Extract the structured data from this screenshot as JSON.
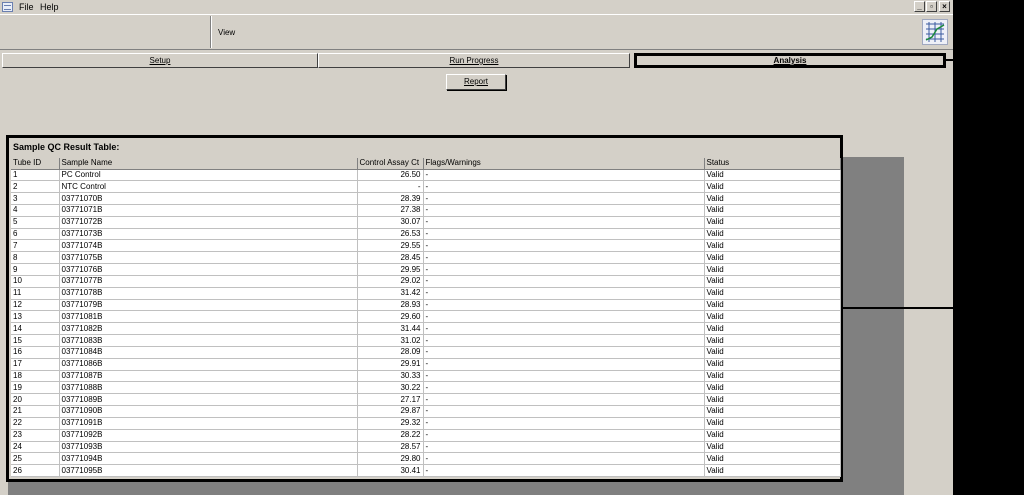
{
  "menu": {
    "file": "File",
    "help": "Help"
  },
  "window_buttons": {
    "minimize": "_",
    "restore": "▫",
    "close": "×"
  },
  "toolbar": {
    "view_label": "View"
  },
  "tabs": [
    {
      "label": "Setup"
    },
    {
      "label": "Run Progress"
    },
    {
      "label": "Analysis"
    }
  ],
  "report_button": "Report",
  "qc_table": {
    "title": "Sample QC Result Table:",
    "columns": [
      "Tube ID",
      "Sample Name",
      "Control Assay Ct",
      "Flags/Warnings",
      "Status"
    ],
    "rows": [
      [
        "1",
        "PC Control",
        "26.50",
        "-",
        "Valid"
      ],
      [
        "2",
        "NTC Control",
        "-",
        "-",
        "Valid"
      ],
      [
        "3",
        "03771070B",
        "28.39",
        "-",
        "Valid"
      ],
      [
        "4",
        "03771071B",
        "27.38",
        "-",
        "Valid"
      ],
      [
        "5",
        "03771072B",
        "30.07",
        "-",
        "Valid"
      ],
      [
        "6",
        "03771073B",
        "26.53",
        "-",
        "Valid"
      ],
      [
        "7",
        "03771074B",
        "29.55",
        "-",
        "Valid"
      ],
      [
        "8",
        "03771075B",
        "28.45",
        "-",
        "Valid"
      ],
      [
        "9",
        "03771076B",
        "29.95",
        "-",
        "Valid"
      ],
      [
        "10",
        "03771077B",
        "29.02",
        "-",
        "Valid"
      ],
      [
        "11",
        "03771078B",
        "31.42",
        "-",
        "Valid"
      ],
      [
        "12",
        "03771079B",
        "28.93",
        "-",
        "Valid"
      ],
      [
        "13",
        "03771081B",
        "29.60",
        "-",
        "Valid"
      ],
      [
        "14",
        "03771082B",
        "31.44",
        "-",
        "Valid"
      ],
      [
        "15",
        "03771083B",
        "31.02",
        "-",
        "Valid"
      ],
      [
        "16",
        "03771084B",
        "28.09",
        "-",
        "Valid"
      ],
      [
        "17",
        "03771086B",
        "29.91",
        "-",
        "Valid"
      ],
      [
        "18",
        "03771087B",
        "30.33",
        "-",
        "Valid"
      ],
      [
        "19",
        "03771088B",
        "30.22",
        "-",
        "Valid"
      ],
      [
        "20",
        "03771089B",
        "27.17",
        "-",
        "Valid"
      ],
      [
        "21",
        "03771090B",
        "29.87",
        "-",
        "Valid"
      ],
      [
        "22",
        "03771091B",
        "29.32",
        "-",
        "Valid"
      ],
      [
        "23",
        "03771092B",
        "28.22",
        "-",
        "Valid"
      ],
      [
        "24",
        "03771093B",
        "28.57",
        "-",
        "Valid"
      ],
      [
        "25",
        "03771094B",
        "29.80",
        "-",
        "Valid"
      ],
      [
        "26",
        "03771095B",
        "30.41",
        "-",
        "Valid"
      ]
    ]
  },
  "icons": {
    "app": "app-grid-icon",
    "logo": "instrument-logo-icon"
  },
  "colors": {
    "window_bg": "#d4d0c8",
    "panel_gray": "#808080",
    "highlight_border": "#000000"
  }
}
